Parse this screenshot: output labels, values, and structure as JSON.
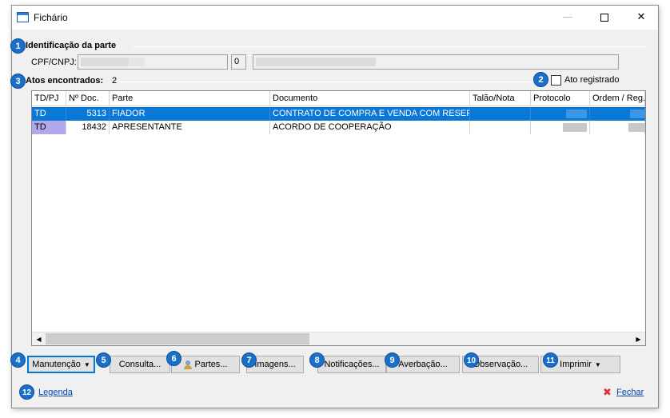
{
  "window": {
    "title": "Fichário",
    "minimize_glyph": "—",
    "close_glyph": "✕"
  },
  "badges": [
    "1",
    "2",
    "3",
    "4",
    "5",
    "6",
    "7",
    "8",
    "9",
    "10",
    "11",
    "12"
  ],
  "identificacao": {
    "section_title": "Identificação da parte",
    "cpf_label": "CPF/CNPJ:",
    "cpf_value": "",
    "code_value": "0",
    "name_value": ""
  },
  "atos": {
    "label": "Atos encontrados:",
    "count": "2",
    "ato_registrado_label": "Ato registrado",
    "ato_registrado_checked": false
  },
  "table": {
    "columns": [
      "TD/PJ",
      "Nº Doc.",
      "Parte",
      "Documento",
      "Talão/Nota",
      "Protocolo",
      "Ordem / Reg."
    ],
    "rows": [
      {
        "tdpj": "TD",
        "num_doc": "5313",
        "parte": "FIADOR",
        "documento": "CONTRATO DE COMPRA E VENDA COM RESERVA",
        "talao": "",
        "selected": true
      },
      {
        "tdpj": "TD",
        "num_doc": "18432",
        "parte": "APRESENTANTE",
        "documento": "ACORDO DE COOPERAÇÃO",
        "talao": "",
        "selected": false
      }
    ]
  },
  "buttons": {
    "manutencao": "Manutenção",
    "consulta": "Consulta...",
    "partes": "Partes...",
    "imagens": "Imagens...",
    "notificacoes": "Notificações...",
    "averbacao": "Averbação...",
    "observacao": "Observação...",
    "imprimir": "Imprimir"
  },
  "footer": {
    "legenda": "Legenda",
    "fechar": "Fechar"
  },
  "icons": {
    "dropdown": "▼",
    "scroll_left": "◀",
    "scroll_right": "▶",
    "close_x": "✖"
  },
  "colors": {
    "badge": "#1b6fc9",
    "selection": "#0a78d7",
    "link": "#0645ad",
    "close": "#e03030"
  }
}
